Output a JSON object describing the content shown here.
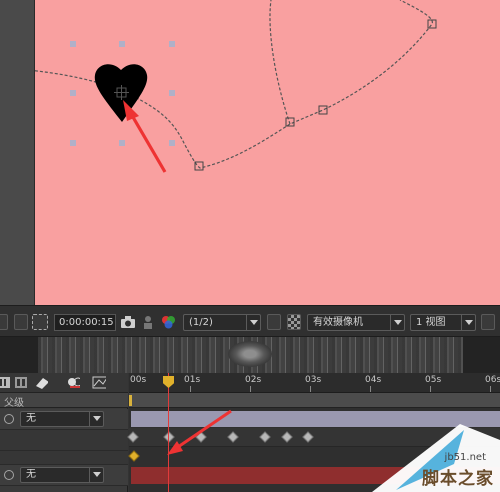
{
  "composition": {
    "background_color": "#f9a0a0",
    "shape_color": "#000000",
    "annotation_arrow_color": "#ee3333"
  },
  "toolbar": {
    "timecode": "0:00:00:15",
    "resolution": "(1/2)",
    "camera": "有效摄像机",
    "view": "1 视图"
  },
  "timeline": {
    "parent_header": "父级",
    "time_markers": [
      "00s",
      "01s",
      "02s",
      "03s",
      "04s",
      "05s",
      "06s"
    ],
    "layers": [
      {
        "parent": "无",
        "bar_color": "#9a98b0"
      },
      {
        "parent": "无",
        "bar_color": "#8f2e2e"
      }
    ],
    "keyframe_color": "#b8b8b8",
    "playhead_color": "#e23b3b"
  },
  "watermark": {
    "url": "jb51.net",
    "name": "脚本之家"
  }
}
